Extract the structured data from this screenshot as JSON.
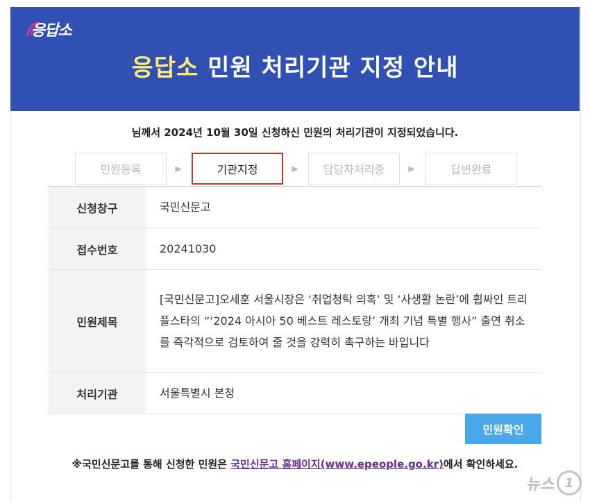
{
  "banner": {
    "logo_text": "응답소",
    "title_accent": "응답소",
    "title_rest": " 민원 처리기관 지정 안내",
    "bg_color": "#3150b3",
    "accent_color": "#fbeb74"
  },
  "notice": "님께서 2024년 10월 30일 신청하신 민원의 처리기관이 지정되었습니다.",
  "steps": [
    {
      "label": "민원등록",
      "active": false
    },
    {
      "label": "기관지정",
      "active": true
    },
    {
      "label": "담당자처리중",
      "active": false
    },
    {
      "label": "답변완료",
      "active": false
    }
  ],
  "info": {
    "rows": [
      {
        "label": "신청창구",
        "value": "국민신문고"
      },
      {
        "label": "접수번호",
        "value": "20241030"
      },
      {
        "label": "민원제목",
        "value": "[국민신문고]오세훈 서울시장은 ‘취업청탁 의혹’ 및 ‘사생활 논란’에 휩싸인 트리플스타의 “‘2024 아시아 50 베스트 레스토랑’ 개최 기념 특별 행사” 출연 취소를 즉각적으로 검토하여 줄 것을 강력히 촉구하는 바입니다"
      },
      {
        "label": "처리기관",
        "value": "서울특별시 본청"
      }
    ]
  },
  "confirm_button": "민원확인",
  "footer": {
    "prefix": "※국민신문고를 통해 신청한 민원은 ",
    "link": "국민신문고 홈페이지(www.epeople.go.kr)",
    "suffix": "에서 확인하세요."
  },
  "watermark": {
    "text": "뉴스",
    "mark": "1"
  },
  "colors": {
    "step_active_border": "#d0302f",
    "button": "#4aa8e9",
    "link": "#6a2d90"
  }
}
